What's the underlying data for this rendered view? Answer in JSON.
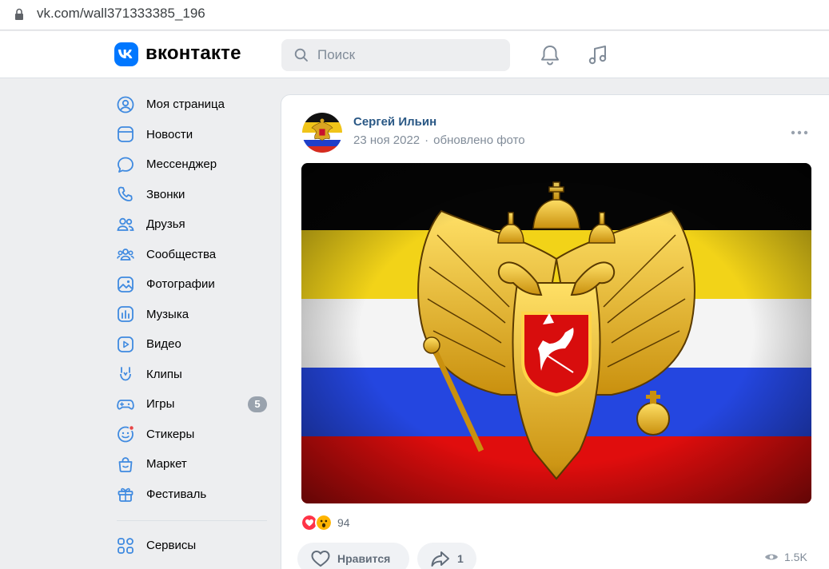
{
  "browser": {
    "url": "vk.com/wall371333385_196"
  },
  "header": {
    "logo_text": "вконтакте",
    "search_placeholder": "Поиск"
  },
  "sidebar": {
    "items": [
      {
        "label": "Моя страница",
        "icon": "user-circle-icon"
      },
      {
        "label": "Новости",
        "icon": "news-icon"
      },
      {
        "label": "Мессенджер",
        "icon": "message-icon"
      },
      {
        "label": "Звонки",
        "icon": "phone-icon"
      },
      {
        "label": "Друзья",
        "icon": "friends-icon"
      },
      {
        "label": "Сообщества",
        "icon": "communities-icon"
      },
      {
        "label": "Фотографии",
        "icon": "photo-icon"
      },
      {
        "label": "Музыка",
        "icon": "music-icon"
      },
      {
        "label": "Видео",
        "icon": "video-icon"
      },
      {
        "label": "Клипы",
        "icon": "clips-icon"
      },
      {
        "label": "Игры",
        "icon": "gamepad-icon",
        "badge": "5"
      },
      {
        "label": "Стикеры",
        "icon": "sticker-icon"
      },
      {
        "label": "Маркет",
        "icon": "market-icon"
      },
      {
        "label": "Фестиваль",
        "icon": "gift-icon"
      }
    ],
    "services_label": "Сервисы"
  },
  "post": {
    "author": "Сергей Ильин",
    "date": "23 ноя 2022",
    "action": "обновлено фото",
    "reactions_count": "94",
    "like_label": "Нравится",
    "share_count": "1",
    "views": "1.5K"
  },
  "colors": {
    "accent": "#0077ff",
    "link": "#2a5885",
    "secondary_text": "#818c99",
    "background": "#edeef0"
  }
}
